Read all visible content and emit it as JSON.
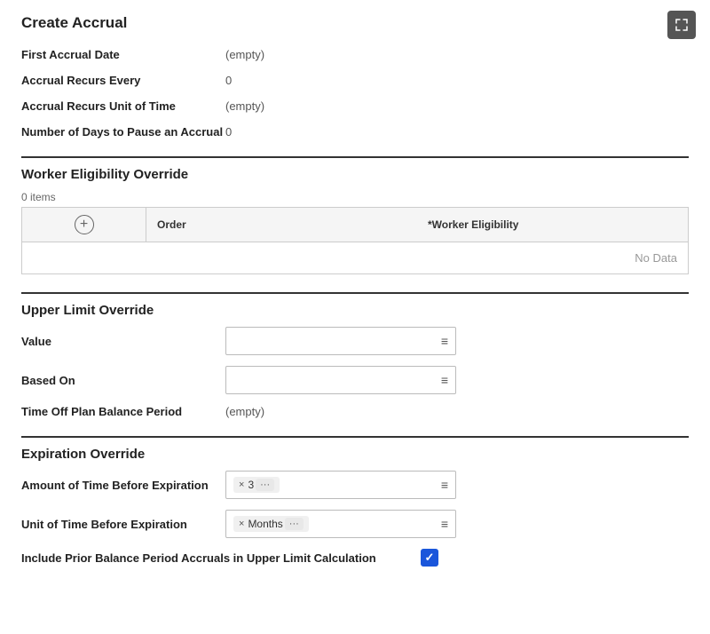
{
  "page": {
    "title": "Create Accrual"
  },
  "fields": {
    "first_accrual_date_label": "First Accrual Date",
    "first_accrual_date_value": "(empty)",
    "accrual_recurs_every_label": "Accrual Recurs Every",
    "accrual_recurs_every_value": "0",
    "accrual_recurs_unit_label": "Accrual Recurs Unit of Time",
    "accrual_recurs_unit_value": "(empty)",
    "number_of_days_label": "Number of Days to Pause an Accrual",
    "number_of_days_value": "0"
  },
  "worker_eligibility": {
    "section_title": "Worker Eligibility Override",
    "items_count": "0 items",
    "col_order": "Order",
    "col_worker_eligibility": "*Worker Eligibility",
    "no_data": "No Data"
  },
  "upper_limit": {
    "section_title": "Upper Limit Override",
    "value_label": "Value",
    "based_on_label": "Based On",
    "time_off_plan_label": "Time Off Plan Balance Period",
    "time_off_plan_value": "(empty)"
  },
  "expiration": {
    "section_title": "Expiration Override",
    "amount_label": "Amount of Time Before Expiration",
    "unit_label": "Unit of Time Before Expiration",
    "include_prior_label": "Include Prior Balance Period Accruals in Upper Limit Calculation",
    "amount_tag_x": "×",
    "amount_tag_value": "3",
    "unit_tag_x": "×",
    "unit_tag_value": "Months"
  },
  "icons": {
    "expand": "expand-icon",
    "add": "+",
    "menu_lines": "≡"
  }
}
